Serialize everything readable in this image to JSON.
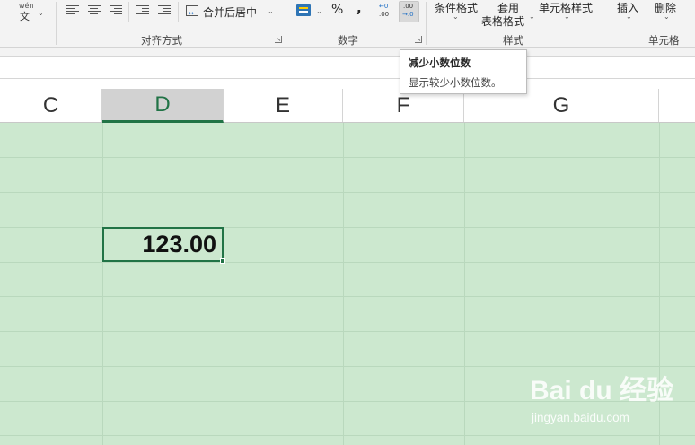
{
  "ribbon": {
    "phonetic_glyph": "wén",
    "phonetic_char": "文",
    "merge_center": "合并后居中",
    "alignment_group": "对齐方式",
    "number_group": "数字",
    "percent": "%",
    "comma": ",",
    "inc_decimal_top": "←0",
    "inc_decimal_bottom": ".00",
    "dec_decimal_top": ".00",
    "dec_decimal_bottom": "→.0",
    "conditional_format": "条件格式",
    "table_format_line1": "套用",
    "table_format_line2": "表格格式",
    "cell_styles": "单元格样式",
    "styles_group": "样式",
    "insert": "插入",
    "delete": "删除",
    "cells_group": "单元格"
  },
  "tooltip": {
    "title": "减少小数位数",
    "description": "显示较少小数位数。"
  },
  "columns": [
    "C",
    "D",
    "E",
    "F",
    "G"
  ],
  "selected_column": "D",
  "active_cell": {
    "value": "123.00"
  },
  "colors": {
    "grid_background": "#cce8cf",
    "selection_green": "#217346",
    "ribbon_background": "#f3f3f3"
  },
  "watermark": {
    "logo": "Bai du 经验",
    "url": "jingyan.baidu.com"
  }
}
